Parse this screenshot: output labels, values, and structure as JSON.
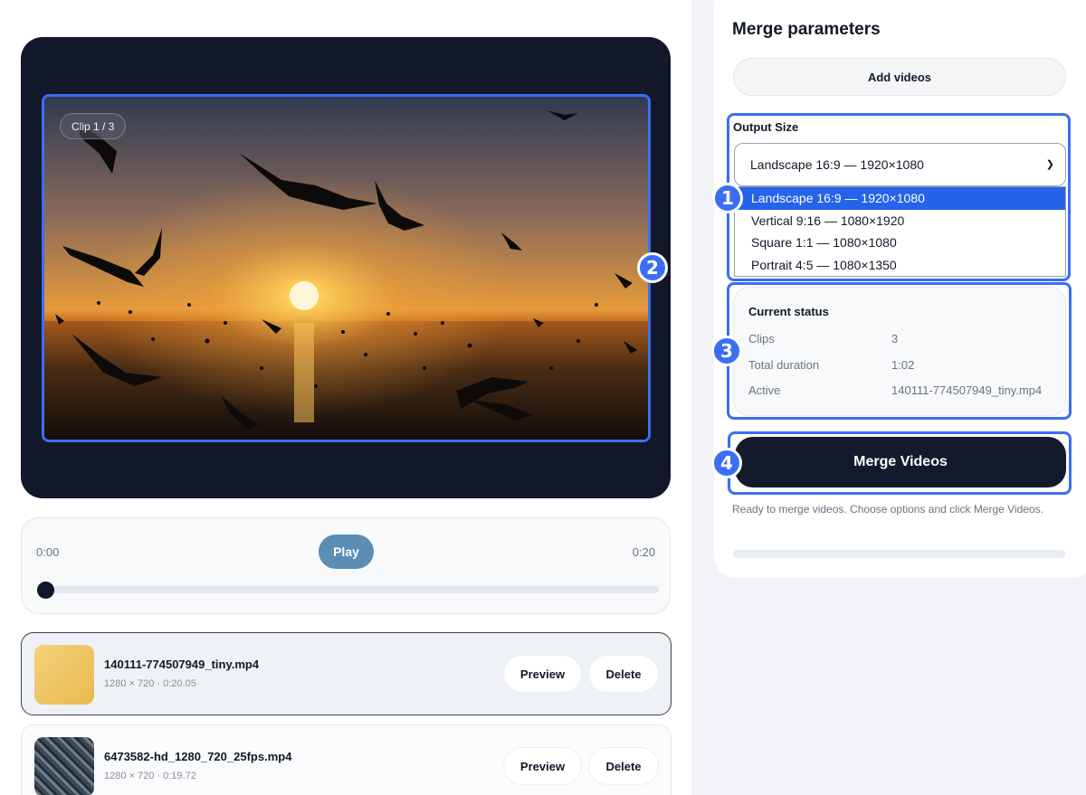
{
  "player": {
    "clip_badge": "Clip 1 / 3",
    "time_start": "0:00",
    "time_end": "0:20",
    "play_label": "Play",
    "progress": 0.0
  },
  "clips": [
    {
      "name": "140111-774507949_tiny.mp4",
      "meta": "1280 × 720 · 0:20.05",
      "preview_label": "Preview",
      "delete_label": "Delete",
      "active": true
    },
    {
      "name": "6473582-hd_1280_720_25fps.mp4",
      "meta": "1280 × 720 · 0:19.72",
      "preview_label": "Preview",
      "delete_label": "Delete",
      "active": false
    }
  ],
  "sidebar": {
    "title": "Merge parameters",
    "add_videos_label": "Add videos",
    "output_size_label": "Output Size",
    "selected_option": "Landscape 16:9 — 1920×1080",
    "options": [
      "Landscape 16:9 — 1920×1080",
      "Vertical 9:16 — 1080×1920",
      "Square 1:1 — 1080×1080",
      "Portrait 4:5 — 1080×1350"
    ],
    "status": {
      "title": "Current status",
      "clips_label": "Clips",
      "clips_value": "3",
      "duration_label": "Total duration",
      "duration_value": "1:02",
      "active_label": "Active",
      "active_value": "140111-774507949_tiny.mp4"
    },
    "merge_label": "Merge Videos",
    "help_text": "Ready to merge videos. Choose options and click Merge Videos."
  },
  "markers": [
    "1",
    "2",
    "3",
    "4"
  ],
  "colors": {
    "accent": "#3b6ef5",
    "dark": "#131a2b",
    "play": "#5b8db5",
    "selected_option": "#2563eb"
  }
}
